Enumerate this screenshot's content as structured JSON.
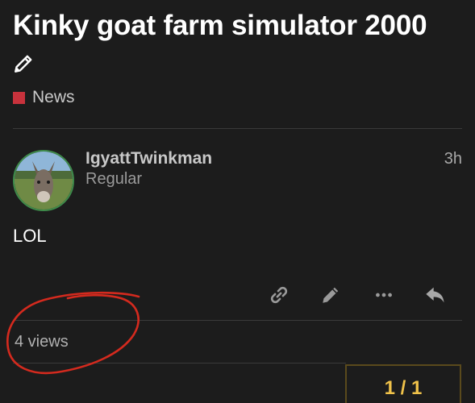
{
  "topic": {
    "title": "Kinky goat farm simulator 2000",
    "category": "News",
    "category_color": "#c8323c"
  },
  "post": {
    "username": "IgyattTwinkman",
    "user_title": "Regular",
    "date": "3h",
    "body": "LOL",
    "avatar": "donkey-photo"
  },
  "actions": [
    {
      "icon": "link-icon"
    },
    {
      "icon": "pencil-icon"
    },
    {
      "icon": "more-icon"
    },
    {
      "icon": "reply-icon"
    }
  ],
  "footer": {
    "views": "4 views"
  },
  "timeline": {
    "position": "1 / 1"
  },
  "colors": {
    "background": "#1c1c1c",
    "annotation": "#d42a1e",
    "timeline_accent": "#f0c24a"
  }
}
